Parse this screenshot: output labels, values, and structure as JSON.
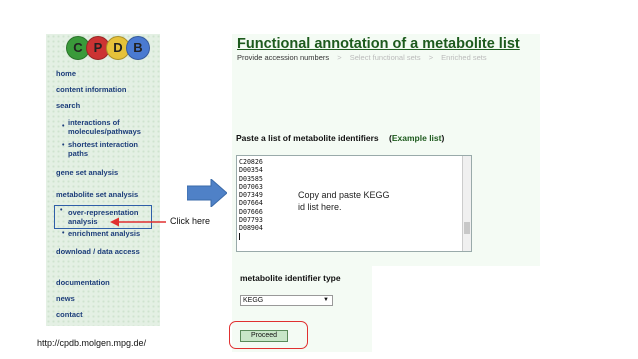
{
  "logo": {
    "letters": [
      "C",
      "P",
      "D",
      "B"
    ],
    "colors": [
      "#3a9a3a",
      "#cc3333",
      "#e6c23a",
      "#4a7ad1"
    ]
  },
  "sidebar": {
    "home": "home",
    "content_information": "content information",
    "search": "search",
    "interactions": [
      "interactions of",
      "molecules/pathways"
    ],
    "shortest_paths": [
      "shortest interaction",
      "paths"
    ],
    "gene_set_analysis": "gene set analysis",
    "metabolite_set_analysis": "metabolite set analysis",
    "over_representation": [
      "over-representation",
      "analysis"
    ],
    "enrichment_analysis": "enrichment analysis",
    "download_data_access": "download / data access",
    "documentation": "documentation",
    "news": "news",
    "contact": "contact"
  },
  "main": {
    "title": "Functional annotation of a metabolite list",
    "breadcrumb": {
      "step1": "Provide accession numbers",
      "sep": ">",
      "step2": "Select functional sets",
      "step3": "Enriched sets"
    },
    "paste_label": "Paste a list of metabolite identifiers",
    "example_open": "(",
    "example_link": "Example list",
    "example_close": ")",
    "ids": [
      "C20826",
      "D00354",
      "D03585",
      "D07063",
      "D07349",
      "D07664",
      "D07666",
      "D07793",
      "D08904"
    ],
    "type_label": "metabolite identifier type",
    "type_value": "KEGG",
    "proceed_label": "Proceed"
  },
  "annotations": {
    "callout": [
      "Copy and paste KEGG",
      "id list here."
    ],
    "click_here": "Click here",
    "url": "http://cpdb.molgen.mpg.de/"
  },
  "colors": {
    "sidebar_bg": "#e4f0e4",
    "panel_bg": "#f4fbf4",
    "title_green": "#1d5a1d",
    "nav_blue": "#1c3d7a",
    "arrow_blue": "#4f81c7",
    "highlight_red": "#e03030"
  }
}
